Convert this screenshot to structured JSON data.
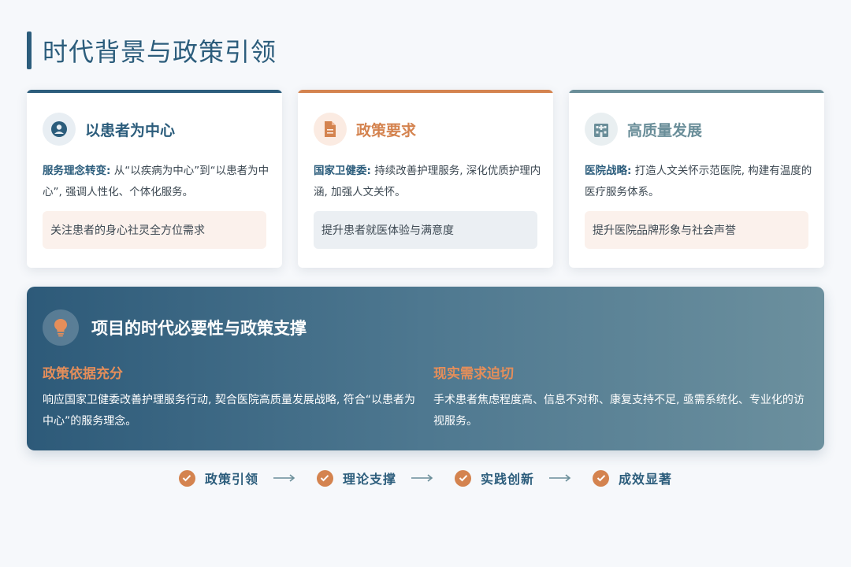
{
  "page": {
    "title": "时代背景与政策引领"
  },
  "cards": [
    {
      "icon": "user-circle-icon",
      "title": "以患者为中心",
      "lead": "服务理念转变:",
      "text": " 从“以疾病为中心”到“以患者为中心”, 强调人性化、个体化服务。",
      "tag": "关注患者的身心社灵全方位需求",
      "accent": "#2c5d7c",
      "tag_bg": "#fbf1ec"
    },
    {
      "icon": "document-icon",
      "title": "政策要求",
      "lead": "国家卫健委:",
      "text": " 持续改善护理服务, 深化优质护理内涵, 加强人文关怀。",
      "tag": "提升患者就医体验与满意度",
      "accent": "#d4834f",
      "tag_bg": "#ebeff3"
    },
    {
      "icon": "hospital-icon",
      "title": "高质量发展",
      "lead": "医院战略:",
      "text": " 打造人文关怀示范医院, 构建有温度的医疗服务体系。",
      "tag": "提升医院品牌形象与社会声誉",
      "accent": "#6a8e99",
      "tag_bg": "#fbf1ec"
    }
  ],
  "banner": {
    "icon": "lightbulb-icon",
    "title": "项目的时代必要性与政策支撑",
    "left": {
      "subtitle": "政策依据充分",
      "text": "响应国家卫健委改善护理服务行动, 契合医院高质量发展战略, 符合“以患者为中心”的服务理念。"
    },
    "right": {
      "subtitle": "现实需求迫切",
      "text": "手术患者焦虑程度高、信息不对称、康复支持不足, 亟需系统化、专业化的访视服务。"
    }
  },
  "flow": {
    "steps": [
      "政策引领",
      "理论支撑",
      "实践创新",
      "成效显著"
    ]
  },
  "colors": {
    "primary": "#2c5d7c",
    "accent": "#d4834f",
    "teal": "#6a8e99"
  }
}
